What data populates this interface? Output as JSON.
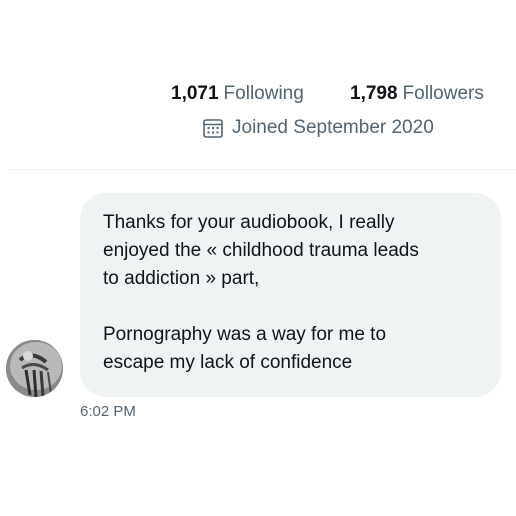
{
  "profile": {
    "following_count": "1,071",
    "following_label": "Following",
    "followers_count": "1,798",
    "followers_label": "Followers",
    "joined_text": "Joined September 2020",
    "joined_icon": "calendar-icon"
  },
  "message": {
    "line1": "Thanks for your audiobook, I really",
    "line2": "enjoyed the « childhood trauma leads",
    "line3": "to addiction » part,",
    "line4": "Pornography was a way for me to",
    "line5": "escape my lack of confidence",
    "time": "6:02 PM",
    "bubble_color": "#eff3f4"
  },
  "colors": {
    "text_primary": "#0f1419",
    "text_secondary": "#536471",
    "divider": "#eff3f4"
  }
}
